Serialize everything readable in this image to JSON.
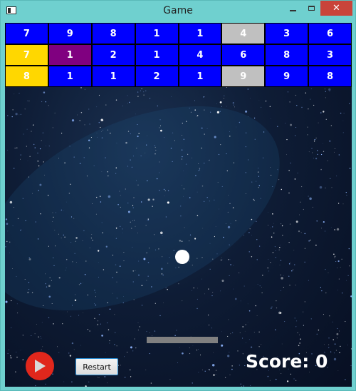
{
  "window": {
    "title": "Game",
    "close_glyph": "✕"
  },
  "bricks": [
    [
      {
        "value": "7",
        "color": "#0000ff"
      },
      {
        "value": "9",
        "color": "#0000ff"
      },
      {
        "value": "8",
        "color": "#0000ff"
      },
      {
        "value": "1",
        "color": "#0000ff"
      },
      {
        "value": "1",
        "color": "#0000ff"
      },
      {
        "value": "4",
        "color": "#c0c0c0"
      },
      {
        "value": "3",
        "color": "#0000ff"
      },
      {
        "value": "6",
        "color": "#0000ff"
      }
    ],
    [
      {
        "value": "7",
        "color": "#ffd700"
      },
      {
        "value": "1",
        "color": "#800080"
      },
      {
        "value": "2",
        "color": "#0000ff"
      },
      {
        "value": "1",
        "color": "#0000ff"
      },
      {
        "value": "4",
        "color": "#0000ff"
      },
      {
        "value": "6",
        "color": "#0000ff"
      },
      {
        "value": "8",
        "color": "#0000ff"
      },
      {
        "value": "3",
        "color": "#0000ff"
      }
    ],
    [
      {
        "value": "8",
        "color": "#ffd700"
      },
      {
        "value": "1",
        "color": "#0000ff"
      },
      {
        "value": "1",
        "color": "#0000ff"
      },
      {
        "value": "2",
        "color": "#0000ff"
      },
      {
        "value": "1",
        "color": "#0000ff"
      },
      {
        "value": "9",
        "color": "#c0c0c0"
      },
      {
        "value": "9",
        "color": "#0000ff"
      },
      {
        "value": "8",
        "color": "#0000ff"
      }
    ]
  ],
  "controls": {
    "play_icon": "play-icon",
    "restart_label": "Restart"
  },
  "score": {
    "text": "Score: 0"
  },
  "colors": {
    "titlebar": "#6fd0cf",
    "close_button": "#c9443a",
    "ball": "#ffffff",
    "paddle": "#808080",
    "play_button": "#e0271c"
  }
}
